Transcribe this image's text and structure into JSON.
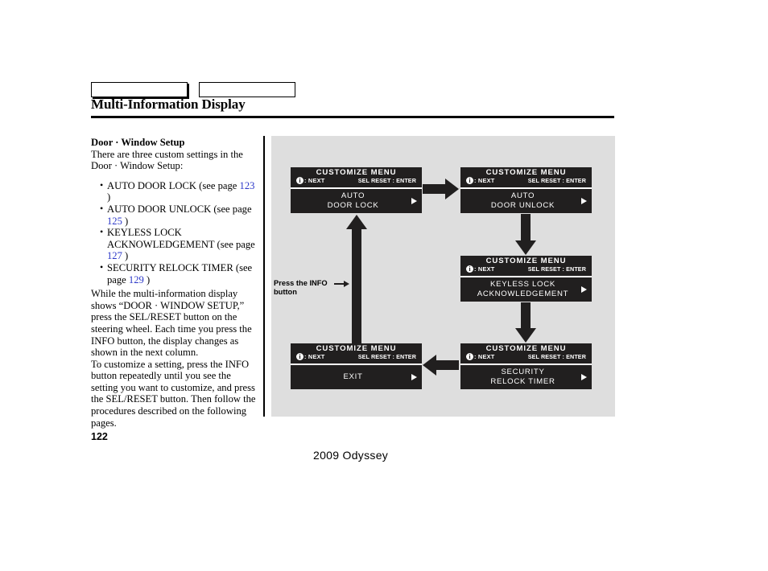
{
  "header": {
    "tabs": [
      "",
      ""
    ],
    "title": "Multi-Information Display"
  },
  "text_column": {
    "section_heading": "Door · Window Setup",
    "intro": "There are three custom settings in the Door · Window Setup:",
    "bullets": [
      {
        "text_before": "AUTO DOOR LOCK (see page ",
        "page_ref": "123",
        "text_after": " )"
      },
      {
        "text_before": "AUTO DOOR UNLOCK (see page ",
        "page_ref": "125",
        "text_after": " )"
      },
      {
        "text_before": "KEYLESS LOCK ACKNOWLEDGEMENT (see page ",
        "page_ref": "127",
        "text_after": " )"
      },
      {
        "text_before": "SECURITY RELOCK TIMER (see page ",
        "page_ref": "129",
        "text_after": " )"
      }
    ],
    "paragraph_1": "While the multi-information display shows “DOOR · WINDOW SETUP,” press the SEL/RESET button on the steering wheel. Each time you press the INFO button, the display changes as shown in the next column.",
    "paragraph_2": "To customize a setting, press the INFO button repeatedly until you see the setting you want to customize, and press the SEL/RESET button. Then follow the procedures described on the following pages."
  },
  "diagram": {
    "background_color": "#dedede",
    "screen_color": "#211f1f",
    "callout": {
      "line1": "Press the INFO",
      "line2": "button"
    },
    "panels": [
      {
        "id": "auto-door-lock",
        "title": "CUSTOMIZE MENU",
        "info_icon": "i",
        "next_label": ": NEXT",
        "sel_label": "SEL RESET : ENTER",
        "lines": [
          "AUTO",
          "DOOR LOCK"
        ],
        "caret": "right-caret"
      },
      {
        "id": "auto-door-unlock",
        "title": "CUSTOMIZE MENU",
        "info_icon": "i",
        "next_label": ": NEXT",
        "sel_label": "SEL RESET : ENTER",
        "lines": [
          "AUTO",
          "DOOR UNLOCK"
        ],
        "caret": "right-caret"
      },
      {
        "id": "keyless-lock",
        "title": "CUSTOMIZE MENU",
        "info_icon": "i",
        "next_label": ": NEXT",
        "sel_label": "SEL RESET : ENTER",
        "lines": [
          "KEYLESS LOCK",
          "ACKNOWLEDGEMENT"
        ],
        "caret": "right-caret"
      },
      {
        "id": "security-relock",
        "title": "CUSTOMIZE MENU",
        "info_icon": "i",
        "next_label": ": NEXT",
        "sel_label": "SEL RESET : ENTER",
        "lines": [
          "SECURITY",
          "RELOCK TIMER"
        ],
        "caret": "right-caret"
      },
      {
        "id": "exit",
        "title": "CUSTOMIZE MENU",
        "info_icon": "i",
        "next_label": ": NEXT",
        "sel_label": "SEL RESET : ENTER",
        "lines": [
          "EXIT"
        ],
        "caret": "right-caret"
      }
    ]
  },
  "footer": {
    "page_number": "122",
    "document": "2009  Odyssey"
  }
}
